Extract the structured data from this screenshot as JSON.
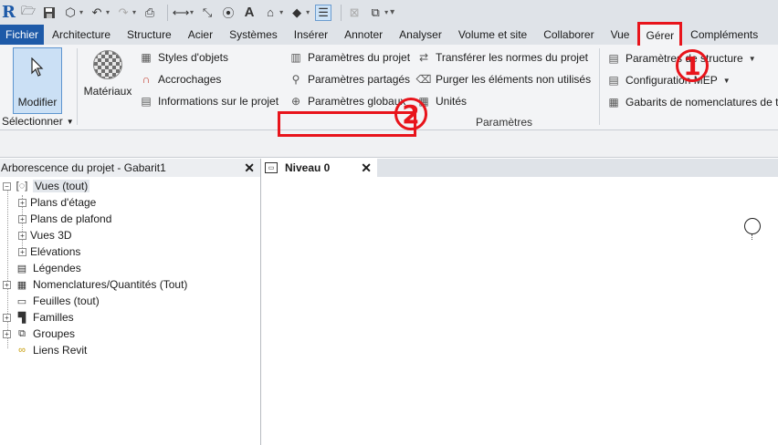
{
  "qat": {
    "logo": "R",
    "icons": [
      "folder-open-icon",
      "save-icon",
      "sync-icon",
      "undo-icon",
      "redo-icon",
      "print-icon",
      "measure-icon",
      "dimension-icon",
      "tag-icon",
      "text-icon",
      "3d-view-icon",
      "section-icon",
      "thin-lines-icon",
      "close-hidden-icon",
      "switch-windows-icon",
      "customize-icon"
    ]
  },
  "tabs": [
    "Fichier",
    "Architecture",
    "Structure",
    "Acier",
    "Systèmes",
    "Insérer",
    "Annoter",
    "Analyser",
    "Volume et site",
    "Collaborer",
    "Vue",
    "Gérer",
    "Compléments"
  ],
  "active_tab_index": 11,
  "ribbon": {
    "modify_label": "Modifier",
    "select_label": "Sélectionner",
    "materials_label": "Matériaux",
    "col1": [
      "Styles d'objets",
      "Accrochages",
      "Informations sur le projet"
    ],
    "col2": [
      "Paramètres du projet",
      "Paramètres partagés",
      "Paramètres  globaux"
    ],
    "col3": [
      "Transférer les normes du projet",
      "Purger les éléments non utilisés",
      "Unités"
    ],
    "col4": [
      "Paramètres de structure",
      "Configuration MEP",
      "Gabarits de nomenclatures de ta"
    ],
    "panel_label": "Paramètres"
  },
  "annotations": {
    "step1": "1",
    "step2": "2",
    "color": "#e8141b"
  },
  "browser": {
    "title": "Arborescence du projet - Gabarit1",
    "nodes": [
      {
        "label": "Vues (tout)",
        "expanded": true
      },
      {
        "label": "Plans d'étage"
      },
      {
        "label": "Plans de plafond"
      },
      {
        "label": "Vues 3D"
      },
      {
        "label": "Elévations"
      },
      {
        "label": "Légendes"
      },
      {
        "label": "Nomenclatures/Quantités (Tout)"
      },
      {
        "label": "Feuilles (tout)"
      },
      {
        "label": "Familles"
      },
      {
        "label": "Groupes"
      },
      {
        "label": "Liens Revit"
      }
    ]
  },
  "view_tab": {
    "label": "Niveau 0"
  },
  "colors": {
    "file_tab": "#1e5aa8",
    "ribbon_bg": "#f3f4f6",
    "highlight": "#e8141b",
    "selected_button": "#cbe0f5"
  }
}
